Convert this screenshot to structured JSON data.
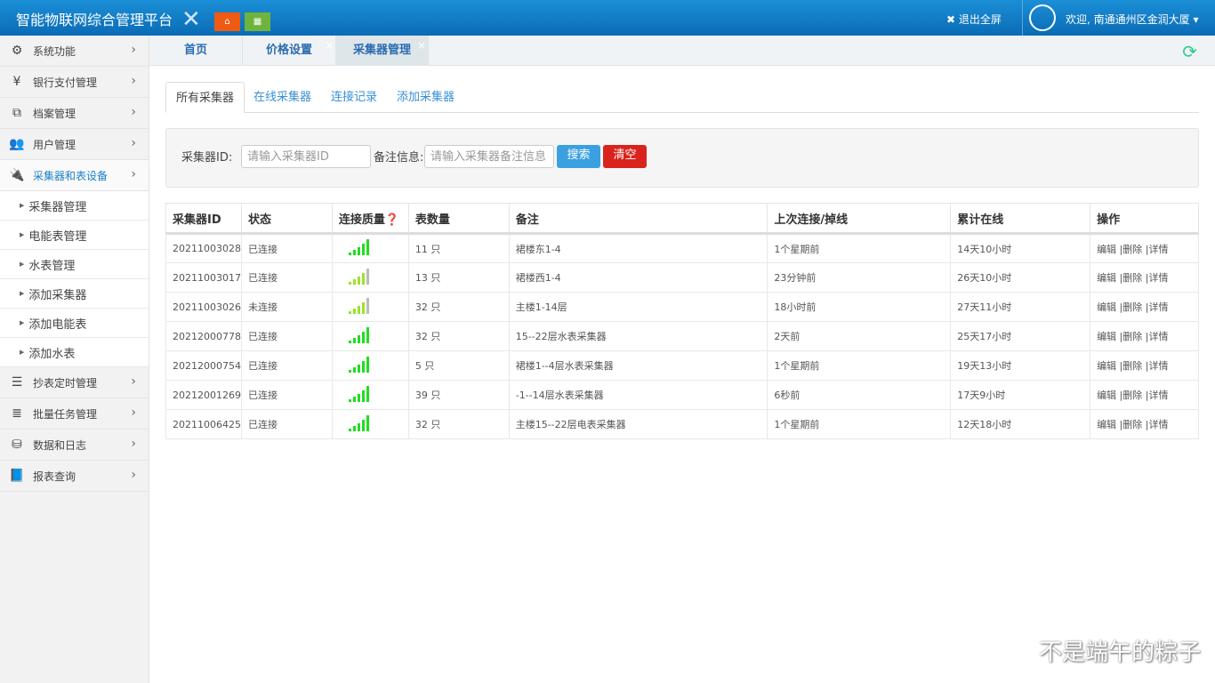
{
  "header": {
    "title": "智能物联网综合管理平台",
    "home_color": "#ef5b12",
    "grid_color": "#6fb33e",
    "fullscreen_label": "退出全屏",
    "welcome": "欢迎, 南通通州区金润大厦"
  },
  "sidebar": {
    "items": [
      {
        "label": "系统功能",
        "icon": "gears-icon"
      },
      {
        "label": "银行支付管理",
        "icon": "yen-icon"
      },
      {
        "label": "档案管理",
        "icon": "files-icon"
      },
      {
        "label": "用户管理",
        "icon": "users-icon"
      },
      {
        "label": "采集器和表设备",
        "icon": "plug-icon",
        "active": true,
        "children": [
          "采集器管理",
          "电能表管理",
          "水表管理",
          "添加采集器",
          "添加电能表",
          "添加水表"
        ]
      },
      {
        "label": "抄表定时管理",
        "icon": "server-icon"
      },
      {
        "label": "批量任务管理",
        "icon": "list-icon"
      },
      {
        "label": "数据和日志",
        "icon": "database-icon"
      },
      {
        "label": "报表查询",
        "icon": "book-icon"
      }
    ]
  },
  "tabs": [
    {
      "label": "首页"
    },
    {
      "label": "价格设置"
    },
    {
      "label": "采集器管理",
      "active": true
    }
  ],
  "subtabs": [
    "所有采集器",
    "在线采集器",
    "连接记录",
    "添加采集器"
  ],
  "search": {
    "id_label": "采集器ID:",
    "id_placeholder": "请输入采集器ID",
    "note_label": "备注信息:",
    "note_placeholder": "请输入采集器备注信息",
    "search_btn": "搜索",
    "clear_btn": "清空",
    "search_color": "#3aa0e0",
    "clear_color": "#d9241d"
  },
  "table": {
    "headers": [
      "采集器ID",
      "状态",
      "连接质量❓",
      "表数量",
      "备注",
      "上次连接/掉线",
      "累计在线",
      "操作"
    ],
    "actions": [
      "编辑",
      "删除",
      "详情"
    ],
    "rows": [
      {
        "id": "20211003028",
        "status": "已连接",
        "ok": true,
        "signal": 5,
        "count": "11 只",
        "note": "裙楼东1-4",
        "last": "1个星期前",
        "online": "14天10小时"
      },
      {
        "id": "20211003017",
        "status": "已连接",
        "ok": true,
        "signal": 4,
        "count": "13 只",
        "note": "裙楼西1-4",
        "last": "23分钟前",
        "online": "26天10小时"
      },
      {
        "id": "20211003026",
        "status": "未连接",
        "ok": false,
        "signal": 4,
        "count": "32 只",
        "note": "主楼1-14层",
        "last": "18小时前",
        "online": "27天11小时"
      },
      {
        "id": "20212000778",
        "status": "已连接",
        "ok": true,
        "signal": 5,
        "count": "32 只",
        "note": "15--22层水表采集器",
        "last": "2天前",
        "online": "25天17小时"
      },
      {
        "id": "20212000754",
        "status": "已连接",
        "ok": true,
        "signal": 5,
        "count": "5 只",
        "note": "裙楼1--4层水表采集器",
        "last": "1个星期前",
        "online": "19天13小时"
      },
      {
        "id": "20212001269",
        "status": "已连接",
        "ok": true,
        "signal": 5,
        "count": "39 只",
        "note": "-1--14层水表采集器",
        "last": "6秒前",
        "online": "17天9小时"
      },
      {
        "id": "20211006425",
        "status": "已连接",
        "ok": true,
        "signal": 5,
        "count": "32 只",
        "note": "主楼15--22层电表采集器",
        "last": "1个星期前",
        "online": "12天18小时"
      }
    ]
  },
  "watermark": "不是端午的粽子"
}
